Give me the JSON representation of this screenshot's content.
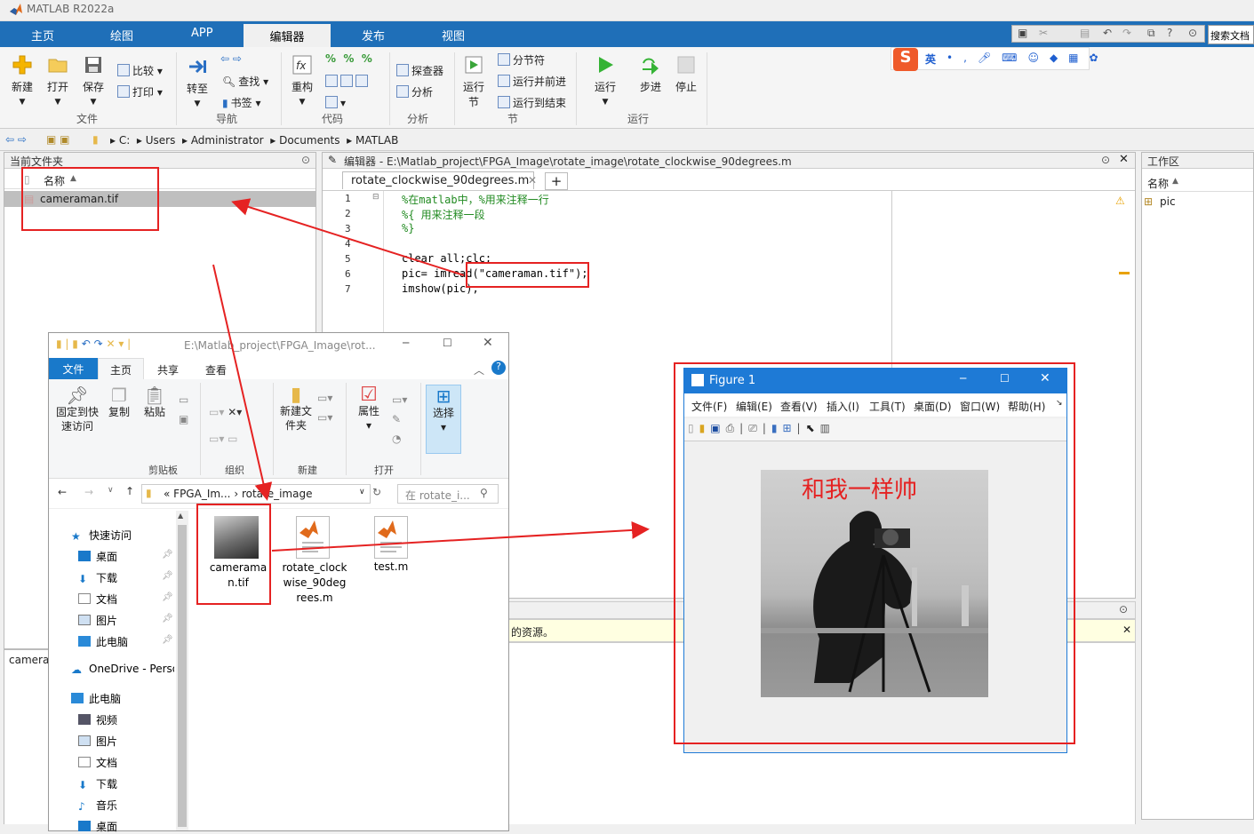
{
  "app": {
    "title": "MATLAB R2022a"
  },
  "tabs": [
    "主页",
    "绘图",
    "APP",
    "编辑器",
    "发布",
    "视图"
  ],
  "search_placeholder": "搜索文档",
  "ribbon": {
    "file": {
      "group": "文件",
      "new": "新建",
      "open": "打开",
      "save": "保存",
      "compare": "比较",
      "print": "打印"
    },
    "nav": {
      "group": "导航",
      "goto": "转至",
      "find": "查找",
      "bookmark": "书签"
    },
    "code": {
      "group": "代码",
      "refactor": "重构"
    },
    "analyze": {
      "group": "分析",
      "profiler": "探查器",
      "analyze": "分析"
    },
    "section": {
      "group": "节",
      "run_section": "运行",
      "run_section2": "节",
      "section_break": "分节符",
      "run_advance": "运行并前进",
      "run_to_end": "运行到结束"
    },
    "run": {
      "group": "运行",
      "run": "运行",
      "step": "步进",
      "stop": "停止"
    }
  },
  "ime": {
    "lang": "英"
  },
  "address": [
    "C:",
    "Users",
    "Administrator",
    "Documents",
    "MATLAB"
  ],
  "current_folder": {
    "title": "当前文件夹",
    "col_name": "名称",
    "files": [
      "cameraman.tif"
    ],
    "detail": "camera"
  },
  "editor": {
    "title": "编辑器 - E:\\Matlab_project\\FPGA_Image\\rotate_image\\rotate_clockwise_90degrees.m",
    "tab": "rotate_clockwise_90degrees.m",
    "lines": [
      {
        "n": "1",
        "t": "%在matlab中，%用来注释一行"
      },
      {
        "n": "2",
        "t": "%{   用来注释一段"
      },
      {
        "n": "3",
        "t": "%}"
      },
      {
        "n": "4",
        "t": ""
      },
      {
        "n": "5",
        "t": "clear all;clc;"
      },
      {
        "n": "6",
        "t": "pic= imread(\"cameraman.tif\");"
      },
      {
        "n": "7",
        "t": "imshow(pic);"
      }
    ]
  },
  "command": {
    "msg": "的资源。"
  },
  "workspace": {
    "title": "工作区",
    "col_name": "名称",
    "vars": [
      "pic"
    ]
  },
  "explorer": {
    "path": "E:\\Matlab_project\\FPGA_Image\\rot...",
    "tabs": [
      "文件",
      "主页",
      "共享",
      "查看"
    ],
    "clipboard": {
      "group": "剪贴板",
      "pin": "固定到快速访问",
      "copy": "复制",
      "paste": "粘贴"
    },
    "organize": {
      "group": "组织"
    },
    "new": {
      "group": "新建",
      "folder": "新建文件夹"
    },
    "open": {
      "group": "打开",
      "props": "属性"
    },
    "select": {
      "label": "选择"
    },
    "crumb1": "«",
    "crumb2": "FPGA_Im...",
    "crumb3": "rotate_image",
    "search": "在 rotate_i...",
    "nav": [
      "快速访问",
      "桌面",
      "下载",
      "文档",
      "图片",
      "此电脑",
      "OneDrive - Perso",
      "此电脑",
      "视频",
      "图片",
      "文档",
      "下载",
      "音乐",
      "桌面"
    ],
    "files": [
      "cameraman.tif",
      "rotate_clockwise_90degrees.m",
      "test.m"
    ]
  },
  "figure": {
    "title": "Figure 1",
    "menus": [
      "文件(F)",
      "编辑(E)",
      "查看(V)",
      "插入(I)",
      "工具(T)",
      "桌面(D)",
      "窗口(W)",
      "帮助(H)"
    ],
    "overlay_text": "和我一样帅"
  },
  "colors": {
    "accent": "#1f6fb8",
    "annotation": "#e52222"
  }
}
